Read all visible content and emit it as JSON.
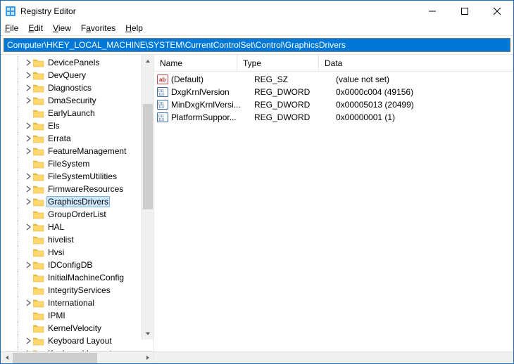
{
  "window": {
    "title": "Registry Editor"
  },
  "menu": {
    "file": "File",
    "edit": "Edit",
    "view": "View",
    "favorites": "Favorites",
    "help": "Help"
  },
  "address": "Computer\\HKEY_LOCAL_MACHINE\\SYSTEM\\CurrentControlSet\\Control\\GraphicsDrivers",
  "tree": {
    "items": [
      {
        "label": "DevicePanels",
        "expandable": true
      },
      {
        "label": "DevQuery",
        "expandable": true
      },
      {
        "label": "Diagnostics",
        "expandable": true
      },
      {
        "label": "DmaSecurity",
        "expandable": true
      },
      {
        "label": "EarlyLaunch",
        "expandable": false
      },
      {
        "label": "Els",
        "expandable": true
      },
      {
        "label": "Errata",
        "expandable": true
      },
      {
        "label": "FeatureManagement",
        "expandable": true
      },
      {
        "label": "FileSystem",
        "expandable": false
      },
      {
        "label": "FileSystemUtilities",
        "expandable": true
      },
      {
        "label": "FirmwareResources",
        "expandable": true
      },
      {
        "label": "GraphicsDrivers",
        "expandable": true,
        "selected": true
      },
      {
        "label": "GroupOrderList",
        "expandable": false
      },
      {
        "label": "HAL",
        "expandable": true
      },
      {
        "label": "hivelist",
        "expandable": false
      },
      {
        "label": "Hvsi",
        "expandable": false
      },
      {
        "label": "IDConfigDB",
        "expandable": true
      },
      {
        "label": "InitialMachineConfig",
        "expandable": false
      },
      {
        "label": "IntegrityServices",
        "expandable": false
      },
      {
        "label": "International",
        "expandable": true
      },
      {
        "label": "IPMI",
        "expandable": false
      },
      {
        "label": "KernelVelocity",
        "expandable": false
      },
      {
        "label": "Keyboard Layout",
        "expandable": true
      },
      {
        "label": "Keyboard Layouts",
        "expandable": true
      }
    ]
  },
  "columns": {
    "name": "Name",
    "type": "Type",
    "data": "Data"
  },
  "values": [
    {
      "icon": "sz",
      "name": "(Default)",
      "type": "REG_SZ",
      "data": "(value not set)"
    },
    {
      "icon": "bin",
      "name": "DxgKrnlVersion",
      "type": "REG_DWORD",
      "data": "0x0000c004 (49156)"
    },
    {
      "icon": "bin",
      "name": "MinDxgKrnlVersi...",
      "type": "REG_DWORD",
      "data": "0x00005013 (20499)"
    },
    {
      "icon": "bin",
      "name": "PlatformSuppor...",
      "type": "REG_DWORD",
      "data": "0x00000001 (1)"
    }
  ]
}
